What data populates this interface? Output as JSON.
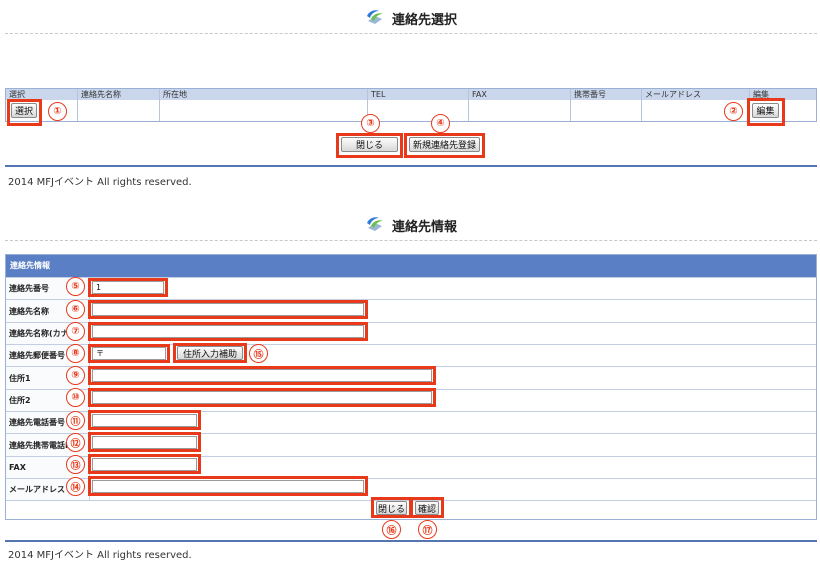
{
  "select_dialog": {
    "title": "連絡先選択",
    "columns": [
      "選択",
      "連絡先名称",
      "所在地",
      "TEL",
      "FAX",
      "携帯番号",
      "メールアドレス",
      "編集"
    ],
    "select_button": "選択",
    "edit_button": "編集",
    "close_button": "閉じる",
    "new_button": "新規連絡先登録",
    "footer": "2014 MFJイベント All rights reserved."
  },
  "info_dialog": {
    "title": "連絡先情報",
    "section_header": "連絡先情報",
    "fields": [
      {
        "label": "連絡先番号",
        "value": "1"
      },
      {
        "label": "連絡先名称",
        "value": ""
      },
      {
        "label": "連絡先名称(カナ",
        "value": ""
      },
      {
        "label": "連絡先郵便番号",
        "value": "〒"
      },
      {
        "label": "住所1",
        "value": ""
      },
      {
        "label": "住所2",
        "value": ""
      },
      {
        "label": "連絡先電話番号",
        "value": ""
      },
      {
        "label": "連絡先携帯電話I",
        "value": ""
      },
      {
        "label": "FAX",
        "value": ""
      },
      {
        "label": "メールアドレス",
        "value": ""
      }
    ],
    "address_helper_button": "住所入力補助",
    "close_button": "閉じる",
    "confirm_button": "確認",
    "footer": "2014 MFJイベント All rights reserved."
  },
  "callouts": [
    "①",
    "②",
    "③",
    "④",
    "⑤",
    "⑥",
    "⑦",
    "⑧",
    "⑨",
    "⑩",
    "⑪",
    "⑫",
    "⑬",
    "⑭",
    "⑮",
    "⑯",
    "⑰"
  ],
  "colors": {
    "accent_red": "#e8391b",
    "header_blue": "#5b7fc4",
    "table_head": "#c9d6ec"
  }
}
